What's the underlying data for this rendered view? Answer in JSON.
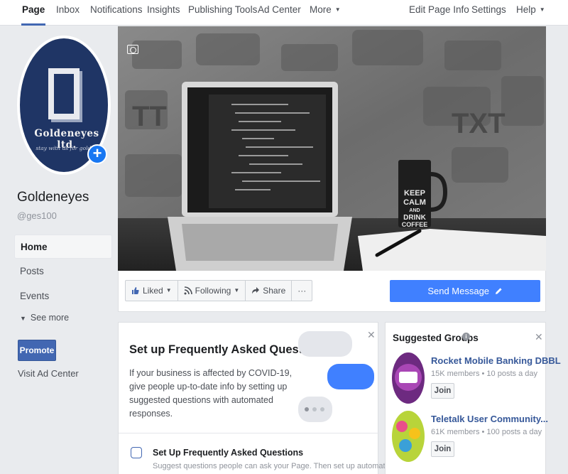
{
  "top_nav": {
    "left_items": [
      "Page",
      "Inbox",
      "Notifications",
      "Insights",
      "Publishing Tools",
      "Ad Center",
      "More"
    ],
    "right_items": [
      "Edit Page Info",
      "Settings",
      "Help"
    ]
  },
  "profile": {
    "logo_text": "Goldeneyes ltd.",
    "logo_tagline": "stay with us for golden",
    "name": "Goldeneyes",
    "handle": "@ges100"
  },
  "side_nav": {
    "items": [
      "Home",
      "Posts",
      "Events"
    ],
    "see_more": "See more",
    "promote": "Promote",
    "visit_ad_center": "Visit Ad Center"
  },
  "cover": {
    "mug_text_1": "KEEP",
    "mug_text_2": "CALM",
    "mug_text_3": "AND",
    "mug_text_4": "DRINK",
    "mug_text_5": "COFFEE"
  },
  "actions": {
    "liked": "Liked",
    "following": "Following",
    "share": "Share",
    "more": "···",
    "send_message": "Send Message"
  },
  "faq": {
    "title": "Set up Frequently Asked Questions",
    "body": "If your business is affected by COVID-19, give people up-to-date info by setting up suggested questions with automated responses.",
    "sub_title": "Set Up Frequently Asked Questions",
    "sub_desc": "Suggest questions people can ask your Page. Then set up automated"
  },
  "groups": {
    "title": "Suggested Groups",
    "items": [
      {
        "name": "Rocket Mobile Banking DBBL",
        "meta": "15K members • 10 posts a day",
        "join": "Join"
      },
      {
        "name": "Teletalk User Community...",
        "meta": "61K members • 100 posts a day",
        "join": "Join"
      }
    ]
  },
  "colors": {
    "accent": "#4267b2",
    "send_button": "#4080ff",
    "logo_bg": "#1f3565"
  }
}
